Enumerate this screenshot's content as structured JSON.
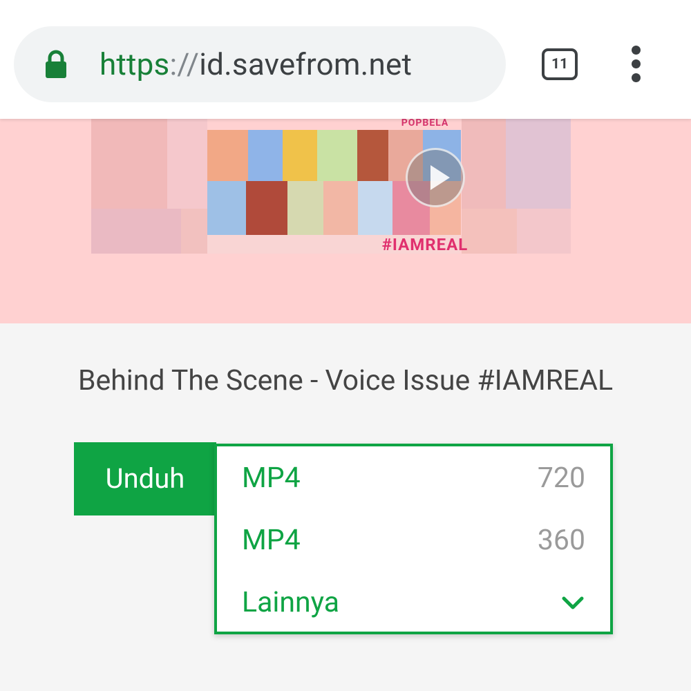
{
  "browser": {
    "url_scheme": "https",
    "url_separator": "://",
    "url_host": "id.savefrom.net",
    "tab_count": "11",
    "icons": {
      "secure": "lock-icon",
      "tabs": "tab-switcher-icon",
      "menu": "more-vert-icon"
    }
  },
  "thumbnail": {
    "brand": "POPBELA",
    "hashtag": "#IAMREAL",
    "overlay_icon": "play-icon"
  },
  "video": {
    "title": "Behind The Scene - Voice Issue #IAMREAL"
  },
  "download": {
    "button_label": "Unduh",
    "options": [
      {
        "format": "MP4",
        "resolution": "720"
      },
      {
        "format": "MP4",
        "resolution": "360"
      }
    ],
    "more_label": "Lainnya",
    "more_icon": "chevron-down-icon"
  },
  "colors": {
    "accent_green": "#0fa444",
    "url_scheme_green": "#188038",
    "banner_pink": "#ffd1d1",
    "hashtag_pink": "#e0306e"
  }
}
